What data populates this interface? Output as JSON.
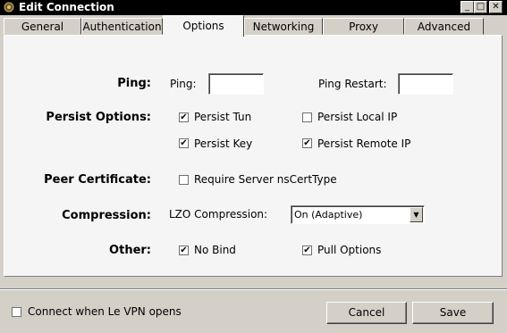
{
  "window": {
    "title": "Edit Connection",
    "controls": {
      "minimize": "_",
      "maximize": "□",
      "close": "✕"
    }
  },
  "tabs": [
    {
      "label": "General"
    },
    {
      "label": "Authentication"
    },
    {
      "label": "Options",
      "active": true
    },
    {
      "label": "Networking"
    },
    {
      "label": "Proxy"
    },
    {
      "label": "Advanced"
    }
  ],
  "options": {
    "ping": {
      "section": "Ping:",
      "ping_label": "Ping:",
      "ping_value": "",
      "restart_label": "Ping Restart:",
      "restart_value": ""
    },
    "persist": {
      "section": "Persist Options:",
      "persist_tun": {
        "label": "Persist Tun",
        "checked": true
      },
      "persist_local_ip": {
        "label": "Persist Local IP",
        "checked": false
      },
      "persist_key": {
        "label": "Persist Key",
        "checked": true
      },
      "persist_remote_ip": {
        "label": "Persist Remote IP",
        "checked": true
      }
    },
    "peer_certificate": {
      "section": "Peer Certificate:",
      "require_ns_cert": {
        "label": "Require Server nsCertType",
        "checked": false
      }
    },
    "compression": {
      "section": "Compression:",
      "lzo_label": "LZO Compression:",
      "lzo_value": "On (Adaptive)"
    },
    "other": {
      "section": "Other:",
      "no_bind": {
        "label": "No Bind",
        "checked": true
      },
      "pull_options": {
        "label": "Pull Options",
        "checked": true
      }
    }
  },
  "footer": {
    "connect_on_open": {
      "label": "Connect when Le VPN opens",
      "checked": false
    },
    "cancel_label": "Cancel",
    "save_label": "Save"
  },
  "check_glyph": "✔"
}
